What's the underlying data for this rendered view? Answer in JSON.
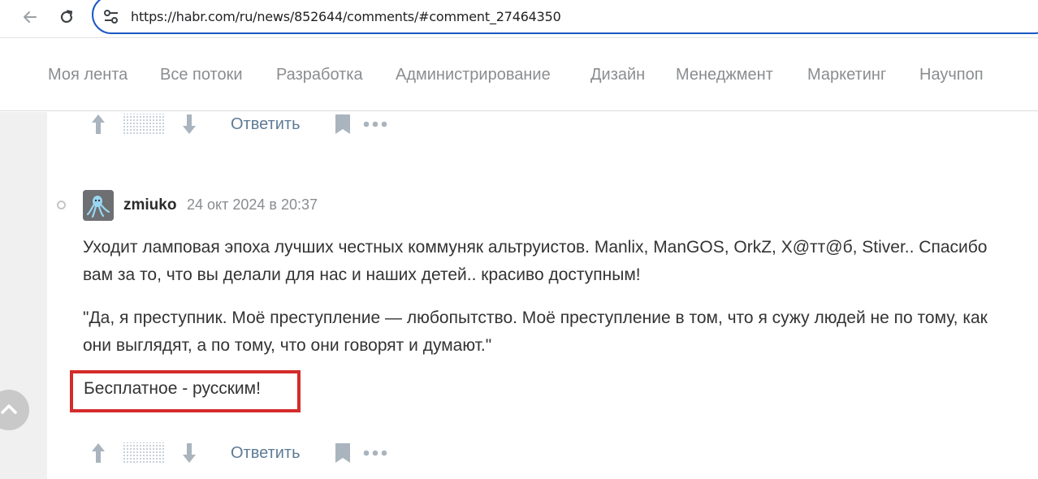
{
  "browser": {
    "url": "https://habr.com/ru/news/852644/comments/#comment_27464350"
  },
  "hubs": [
    "Моя лента",
    "Все потоки",
    "Разработка",
    "Администрирование",
    "Дизайн",
    "Менеджмент",
    "Маркетинг",
    "Научпоп"
  ],
  "comment_actions": {
    "reply_label": "Ответить"
  },
  "comment": {
    "username": "zmiuko",
    "timestamp": "24 окт 2024 в 20:37",
    "paragraphs": [
      "Уходит ламповая эпоха лучших честных коммуняк альтруистов. Manlix, ManGOS, OrkZ, X@тт@б, Stiver.. Спасибо вам за то, что вы делали для нас и наших детей.. красиво доступным!",
      "\"Да, я преступник. Моё преступление — любопытство. Моё преступление в том, что я сужу людей не по тому, как они выглядят, а по тому, что они говорят и думают.\"",
      "Бесплатное - русским!"
    ]
  },
  "colors": {
    "accent_url_border": "#1a57c4",
    "reply_link": "#5e7b96",
    "highlight_box": "#d42b2b",
    "hub_text": "#8a8d90"
  },
  "icons": [
    "back-arrow-icon",
    "reload-icon",
    "site-settings-icon",
    "upvote-icon",
    "score-hidden-icon",
    "downvote-icon",
    "bookmark-icon",
    "more-icon",
    "scroll-up-icon"
  ]
}
